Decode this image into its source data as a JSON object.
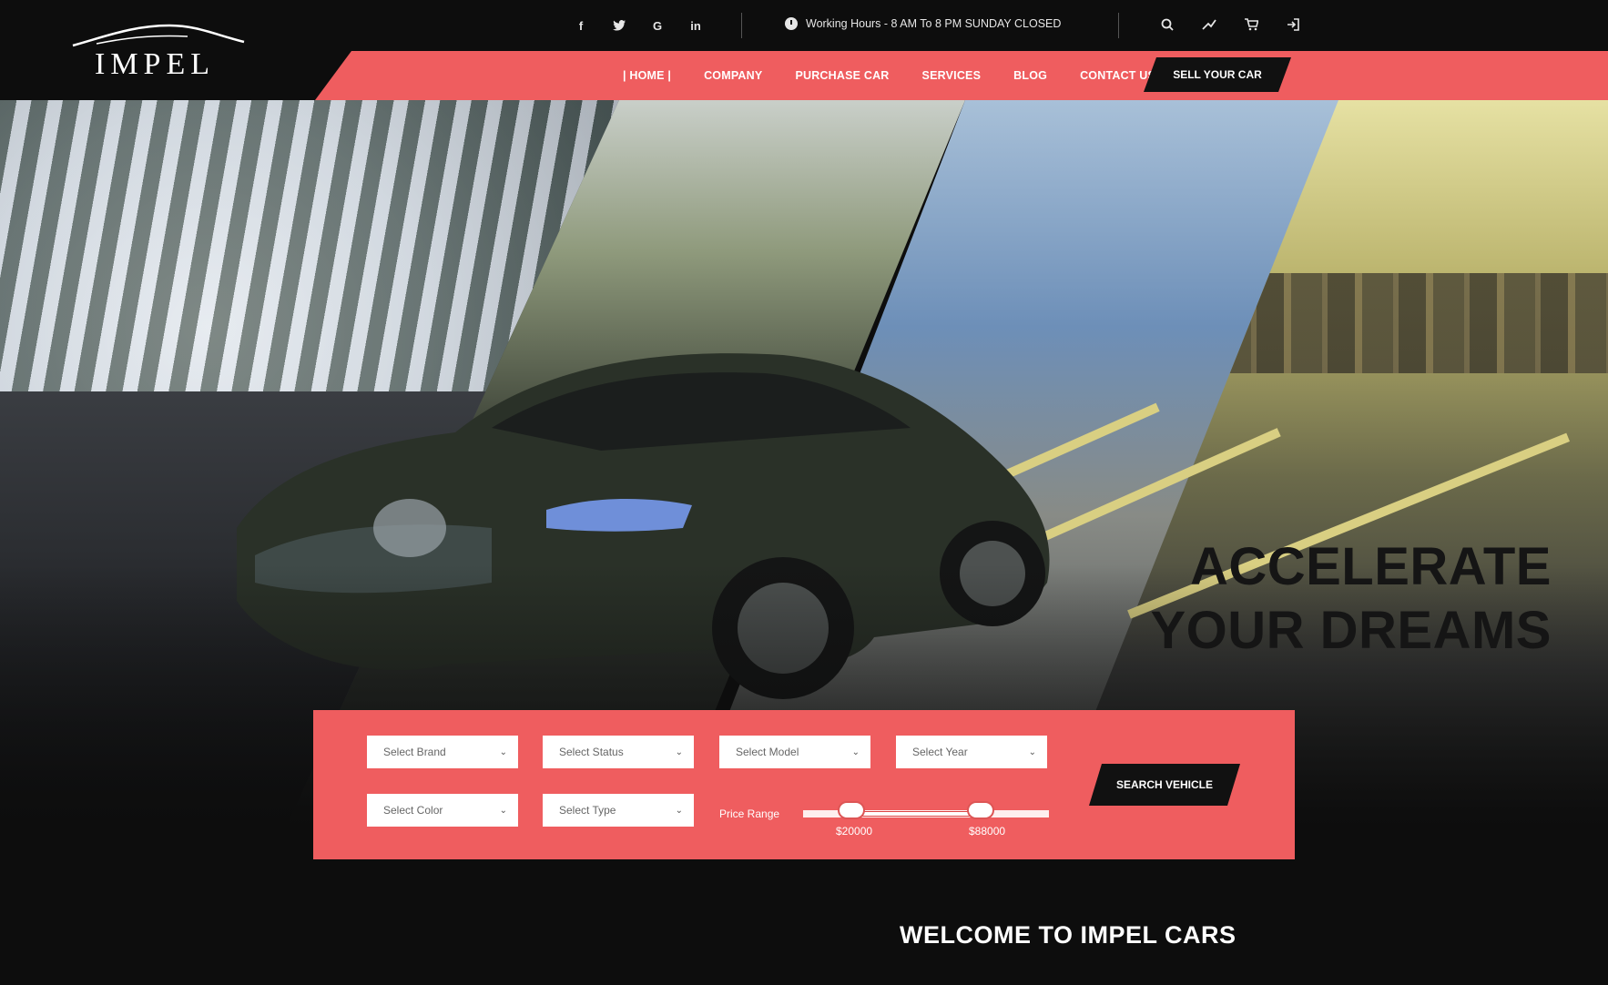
{
  "brand": {
    "logo_text": "IMPEL"
  },
  "topbar": {
    "social": [
      "facebook-icon",
      "twitter-icon",
      "google-plus-icon",
      "linkedin-icon"
    ],
    "working_hours": "Working Hours - 8 AM To 8 PM  SUNDAY CLOSED",
    "tools": [
      "search-icon",
      "compare-icon",
      "cart-icon",
      "login-icon"
    ]
  },
  "nav": {
    "items": [
      "HOME",
      "COMPANY",
      "PURCHASE CAR",
      "SERVICES",
      "BLOG",
      "CONTACT US"
    ],
    "active": "HOME",
    "cta": "SELL YOUR CAR"
  },
  "hero": {
    "line1": "ACCELERATE",
    "line2": "YOUR DREAMS"
  },
  "search": {
    "selects": {
      "brand": "Select Brand",
      "status": "Select Status",
      "model": "Select Model",
      "year": "Select Year",
      "color": "Select Color",
      "type": "Select Type"
    },
    "price_label": "Price Range",
    "price_min": "$20000",
    "price_max": "$88000",
    "button": "SEARCH VEHICLE"
  },
  "welcome": {
    "title": "WELCOME TO IMPEL CARS"
  },
  "colors": {
    "accent": "#ef5d5f",
    "dark": "#0d0d0d",
    "button": "#111111"
  }
}
